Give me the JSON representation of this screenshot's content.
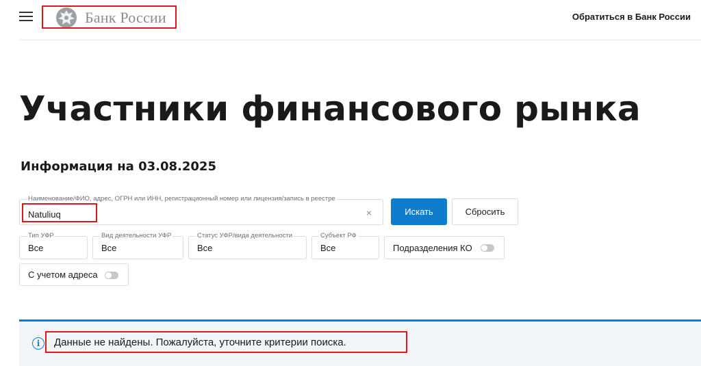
{
  "header": {
    "logo_text": "Банк России",
    "contact_link": "Обратиться в Банк России"
  },
  "page": {
    "title": "Участники финансового рынка",
    "info_date": "Информация на 03.08.2025"
  },
  "search": {
    "label": "Наименование/ФИО, адрес, ОГРН или ИНН, регистрационный номер или лицензия/запись в реестре",
    "value": "Natuliuq",
    "clear_symbol": "×",
    "search_button": "Искать",
    "reset_button": "Сбросить"
  },
  "filters": {
    "type": {
      "label": "Тип УФР",
      "value": "Все"
    },
    "activity": {
      "label": "Вид деятельности УФР",
      "value": "Все"
    },
    "status": {
      "label": "Статус УФР/вида деятельности",
      "value": "Все"
    },
    "subject": {
      "label": "Субъект РФ",
      "value": "Все"
    },
    "ko_toggle": {
      "label": "Подразделения КО",
      "checked": false
    },
    "address_toggle": {
      "label": "С учетом адреса",
      "checked": false
    }
  },
  "alert": {
    "icon": "i",
    "message": "Данные не найдены. Пожалуйста, уточните критерии поиска."
  },
  "colors": {
    "accent": "#0f7dcb",
    "highlight_box": "#e0161b",
    "alert_bg": "#f2f5f7"
  }
}
